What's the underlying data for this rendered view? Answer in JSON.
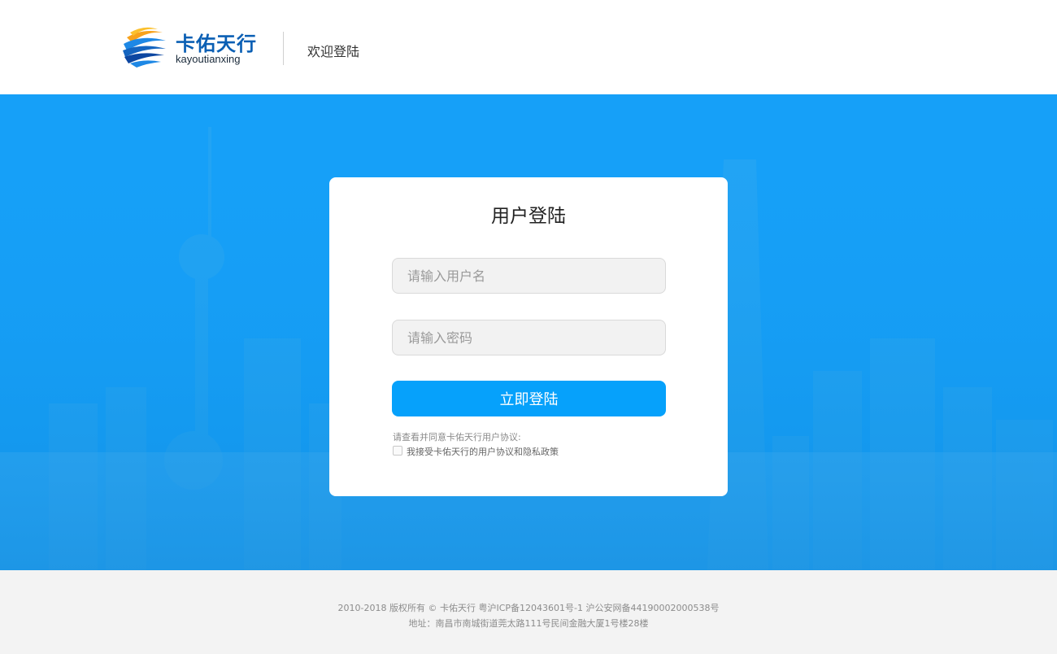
{
  "header": {
    "logo_cn": "卡佑天行",
    "logo_en": "kayoutianxing",
    "welcome": "欢迎登陆"
  },
  "login": {
    "title": "用户登陆",
    "username_placeholder": "请输入用户名",
    "password_placeholder": "请输入密码",
    "submit_label": "立即登陆",
    "agreement_hint": "请查看并同意卡佑天行用户协议:",
    "agreement_label": "我接受卡佑天行的用户协议和隐私政策",
    "agreement_checked": false
  },
  "footer": {
    "copyright": "2010-2018 版权所有 © 卡佑天行 粤沪ICP备12043601号-1 沪公安网备44190002000538号",
    "address": "地址：南昌市南城街道莞太路111号民间金融大厦1号楼28楼"
  },
  "colors": {
    "brand_blue": "#0a5fb4",
    "banner_blue": "#16a0f8",
    "button_blue": "#06a1fb",
    "logo_orange": "#f7a21b"
  }
}
